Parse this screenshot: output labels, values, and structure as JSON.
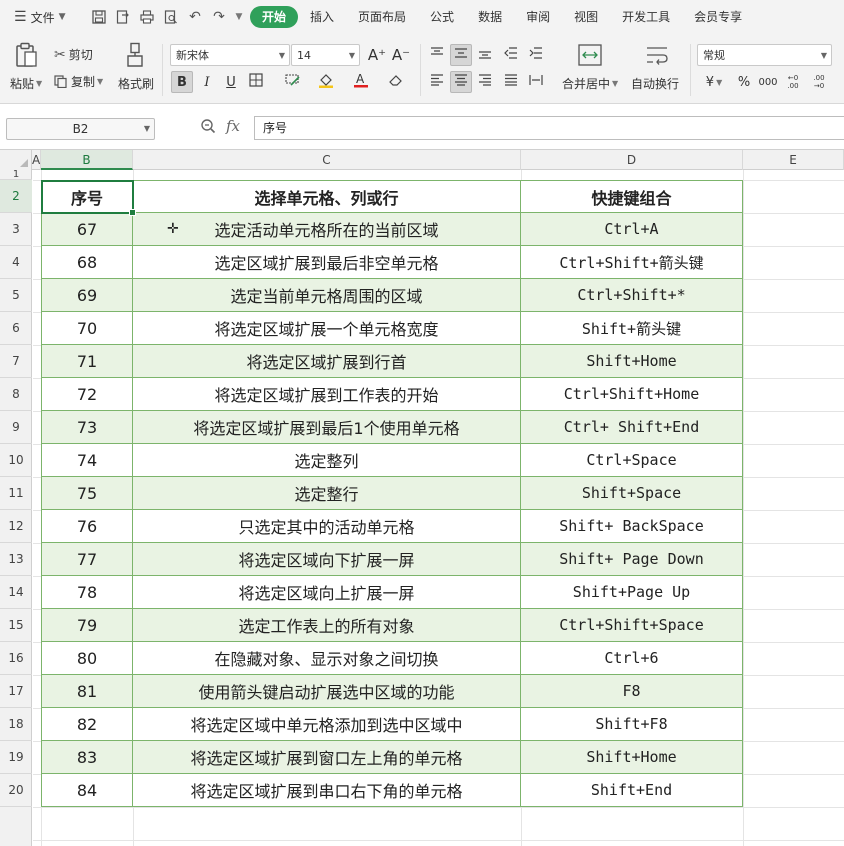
{
  "menubar": {
    "file_label": "文件",
    "tabs": [
      {
        "label": "开始",
        "active": true
      },
      {
        "label": "插入"
      },
      {
        "label": "页面布局"
      },
      {
        "label": "公式"
      },
      {
        "label": "数据"
      },
      {
        "label": "审阅"
      },
      {
        "label": "视图"
      },
      {
        "label": "开发工具"
      },
      {
        "label": "会员专享"
      }
    ],
    "quick_icons": [
      "save-icon",
      "export-pdf-icon",
      "print-icon",
      "print-preview-icon",
      "undo-icon",
      "redo-icon"
    ]
  },
  "ribbon": {
    "paste_label": "粘贴",
    "cut_label": "剪切",
    "copy_label": "复制",
    "format_painter_label": "格式刷",
    "font_name": "新宋体",
    "font_size": "14",
    "merge_label": "合并居中",
    "wrap_label": "自动换行",
    "number_format": "常规",
    "glyphs": {
      "grow_font": "A⁺",
      "shrink_font": "A⁻",
      "bold": "B",
      "italic": "I",
      "underline": "U",
      "currency": "¥",
      "percent": "%",
      "thousands": "000",
      "inc_decimal": "←0 .00",
      "dec_decimal": ".00 →0"
    }
  },
  "formula_bar": {
    "name_box": "B2",
    "fx_label": "fx",
    "content": "序号"
  },
  "sheet": {
    "columns": [
      "A",
      "B",
      "C",
      "D",
      "E"
    ],
    "selected_column": "B",
    "rows": [
      "1",
      "2",
      "3",
      "4",
      "5",
      "6",
      "7",
      "8",
      "9",
      "10",
      "11",
      "12",
      "13",
      "14",
      "15",
      "16",
      "17",
      "18",
      "19",
      "20"
    ],
    "selected_row": "2",
    "table": {
      "headers": [
        "序号",
        "选择单元格、列或行",
        "快捷键组合"
      ],
      "rows": [
        [
          "67",
          "选定活动单元格所在的当前区域",
          "Ctrl+A"
        ],
        [
          "68",
          "选定区域扩展到最后非空单元格",
          "Ctrl+Shift+箭头键"
        ],
        [
          "69",
          "选定当前单元格周围的区域",
          "Ctrl+Shift+*"
        ],
        [
          "70",
          "将选定区域扩展一个单元格宽度",
          "Shift+箭头键"
        ],
        [
          "71",
          "将选定区域扩展到行首",
          "Shift+Home"
        ],
        [
          "72",
          "将选定区域扩展到工作表的开始",
          "Ctrl+Shift+Home"
        ],
        [
          "73",
          "将选定区域扩展到最后1个使用单元格",
          "Ctrl+ Shift+End"
        ],
        [
          "74",
          "选定整列",
          "Ctrl+Space"
        ],
        [
          "75",
          "选定整行",
          "Shift+Space"
        ],
        [
          "76",
          "只选定其中的活动单元格",
          "Shift+ BackSpace"
        ],
        [
          "77",
          "将选定区域向下扩展一屏",
          "Shift+ Page Down"
        ],
        [
          "78",
          "将选定区域向上扩展一屏",
          "Shift+Page Up"
        ],
        [
          "79",
          "选定工作表上的所有对象",
          "Ctrl+Shift+Space"
        ],
        [
          "80",
          "在隐藏对象、显示对象之间切换",
          "Ctrl+6"
        ],
        [
          "81",
          "使用箭头键启动扩展选中区域的功能",
          "F8"
        ],
        [
          "82",
          "将选定区域中单元格添加到选中区域中",
          "Shift+F8"
        ],
        [
          "83",
          "将选定区域扩展到窗口左上角的单元格",
          "Shift+Home"
        ],
        [
          "84",
          "将选定区域扩展到串口右下角的单元格",
          "Shift+End"
        ]
      ]
    }
  },
  "colors": {
    "accent": "#2fa05a",
    "table_border": "#7cb46b",
    "stripe": "#e9f3e3",
    "selection": "#1f7d3f"
  }
}
